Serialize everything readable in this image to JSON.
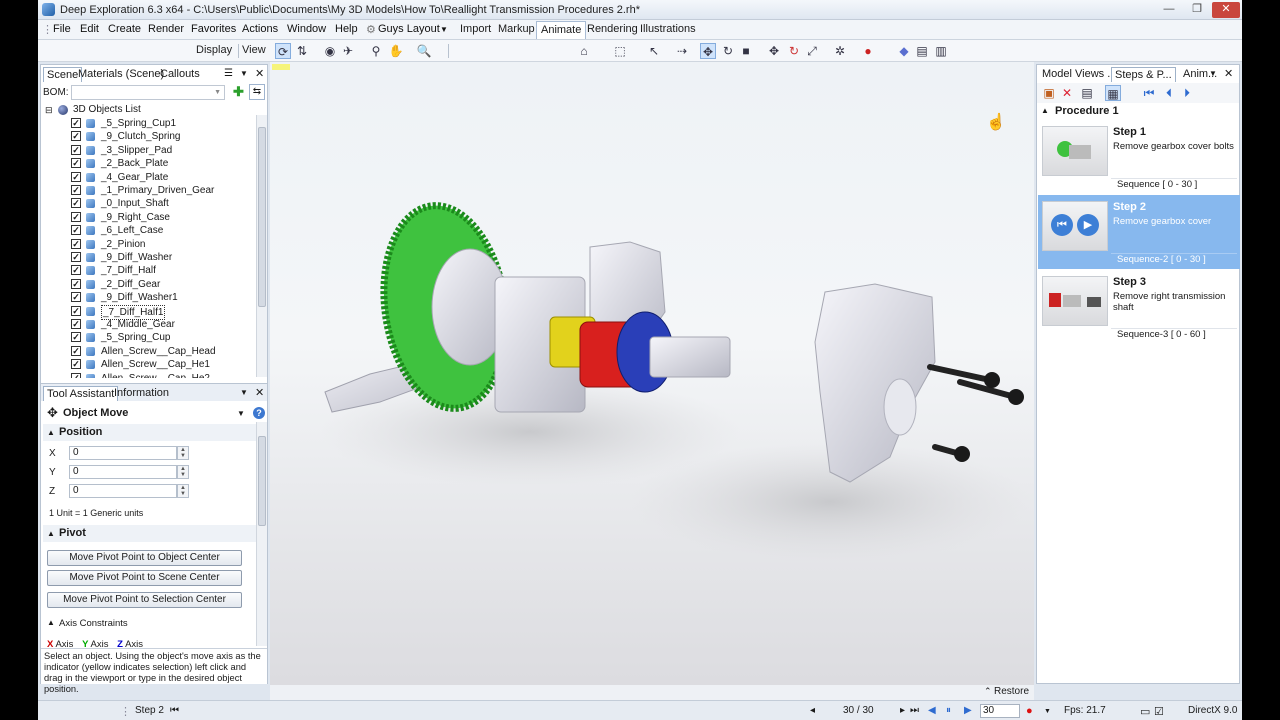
{
  "window": {
    "title": "Deep Exploration 6.3 x64 - C:\\Users\\Public\\Documents\\My 3D Models\\How To\\Reallight Transmission Procedures 2.rh*",
    "minimize": "—",
    "maximize": "❐",
    "close": "✕"
  },
  "menu": [
    "File",
    "Edit",
    "Create",
    "Render",
    "Favorites",
    "Actions",
    "Window",
    "Help"
  ],
  "layout_menu": "Guys Layout",
  "ribbon_tabs": [
    "Import",
    "Markup",
    "Animate",
    "Rendering",
    "Illustrations"
  ],
  "ribbon_active": "Animate",
  "toolbar": {
    "display": "Display",
    "view": "View"
  },
  "left_panel": {
    "tabs": [
      "Scene",
      "Materials (Scene)",
      "Callouts"
    ],
    "bom_label": "BOM:",
    "tree_root": "3D Objects List",
    "objects": [
      "_5_Spring_Cup1",
      "_9_Clutch_Spring",
      "_3_Slipper_Pad",
      "_2_Back_Plate",
      "_4_Gear_Plate",
      "_1_Primary_Driven_Gear",
      "_0_Input_Shaft",
      "_9_Right_Case",
      "_6_Left_Case",
      "_2_Pinion",
      "_9_Diff_Washer",
      "_7_Diff_Half",
      "_2_Diff_Gear",
      "_9_Diff_Washer1",
      "_7_Diff_Half1",
      "_4_Middle_Gear",
      "_5_Spring_Cup",
      "Allen_Screw__Cap_Head",
      "Allen_Screw__Cap_He1",
      "Allen_Screw__Cap_He2"
    ],
    "selected_object": "_7_Diff_Half1",
    "assistant_tabs": [
      "Tool Assistant",
      "Information"
    ],
    "tool_title": "Object Move",
    "position_header": "Position",
    "position": [
      {
        "axis": "X",
        "value": "0"
      },
      {
        "axis": "Y",
        "value": "0"
      },
      {
        "axis": "Z",
        "value": "0"
      }
    ],
    "unit_note": "1 Unit = 1 Generic units",
    "pivot_header": "Pivot",
    "pivot_buttons": [
      "Move Pivot Point to Object Center",
      "Move Pivot Point to Scene Center",
      "Move Pivot Point to Selection Center"
    ],
    "axis_header": "Axis Constraints",
    "axis_items": [
      "Axis",
      "Axis",
      "Axis"
    ],
    "help_text": "Select an object. Using the object's move axis as the indicator (yellow indicates selection) left click and drag in the viewport or type in the desired object position."
  },
  "right_panel": {
    "tabs": [
      "Model Views ...",
      "Steps & P...",
      "Anim..."
    ],
    "procedure": "Procedure 1",
    "steps": [
      {
        "title": "Step 1",
        "desc": "Remove gearbox cover bolts",
        "sequence": "Sequence [ 0 - 30 ]"
      },
      {
        "title": "Step 2",
        "desc": "Remove gearbox cover",
        "sequence": "Sequence-2 [ 0 - 30 ]"
      },
      {
        "title": "Step 3",
        "desc": "Remove right transmission shaft",
        "sequence": "Sequence-3 [ 0 - 60 ]"
      }
    ],
    "selected_step": 1
  },
  "viewport": {
    "restore": "Restore"
  },
  "status": {
    "step": "Step 2",
    "frame": "30 / 30",
    "frame_input": "30",
    "fps": "Fps: 21.7",
    "renderer": "DirectX 9.0"
  }
}
